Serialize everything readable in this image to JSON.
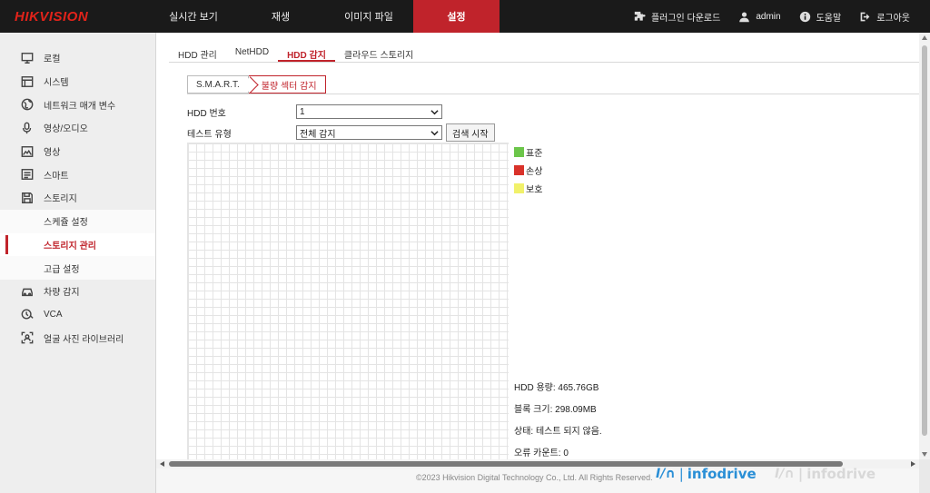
{
  "header": {
    "logo": "HIKVISION",
    "nav": [
      {
        "label": "실시간 보기"
      },
      {
        "label": "재생"
      },
      {
        "label": "이미지 파일"
      },
      {
        "label": "설정"
      }
    ],
    "right": {
      "plugin": "플러그인 다운로드",
      "user": "admin",
      "help": "도움말",
      "logout": "로그아웃"
    }
  },
  "sidebar": {
    "items": [
      {
        "label": "로컬",
        "icon": "monitor-icon"
      },
      {
        "label": "시스템",
        "icon": "window-icon"
      },
      {
        "label": "네트워크 매개 변수",
        "icon": "globe-icon"
      },
      {
        "label": "영상/오디오",
        "icon": "microphone-icon"
      },
      {
        "label": "영상",
        "icon": "image-icon"
      },
      {
        "label": "스마트",
        "icon": "smart-icon"
      },
      {
        "label": "스토리지",
        "icon": "storage-icon"
      }
    ],
    "sub_items": [
      {
        "label": "스케쥴 설정"
      },
      {
        "label": "스토리지 관리"
      },
      {
        "label": "고급 설정"
      }
    ],
    "items_after": [
      {
        "label": "차량 감지",
        "icon": "vehicle-icon"
      },
      {
        "label": "VCA",
        "icon": "vca-icon"
      },
      {
        "label": "얼굴 사진 라이브러리",
        "icon": "face-icon"
      }
    ]
  },
  "tabs": [
    {
      "label": "HDD 관리"
    },
    {
      "label": "NetHDD"
    },
    {
      "label": "HDD 감지"
    },
    {
      "label": "클라우드 스토리지"
    }
  ],
  "subtabs": [
    {
      "label": "S.M.A.R.T."
    },
    {
      "label": "불량 섹터 감지"
    }
  ],
  "form": {
    "hdd_no_label": "HDD 번호",
    "hdd_no_value": "1",
    "test_type_label": "테스트 유형",
    "test_type_value": "전체 감지",
    "start_button": "검색 시작"
  },
  "legend": [
    {
      "label": "표준",
      "color": "#6cc64a"
    },
    {
      "label": "손상",
      "color": "#d9322a"
    },
    {
      "label": "보호",
      "color": "#f1f16a"
    }
  ],
  "info": {
    "capacity": "HDD 용량: 465.76GB",
    "block_size": "블록 크기: 298.09MB",
    "status": "상태: 테스트 되지 않음.",
    "error_count": "오류 카운트: 0"
  },
  "footer": {
    "copyright": "©2023 Hikvision Digital Technology Co., Ltd. All Rights Reserved."
  },
  "watermarks": [
    {
      "mark": "I/∩",
      "text": "infodrive"
    },
    {
      "mark": "I/∩",
      "text": "infodrive"
    }
  ],
  "colors": {
    "accent": "#c0232b",
    "topbar": "#1a1a1a"
  }
}
